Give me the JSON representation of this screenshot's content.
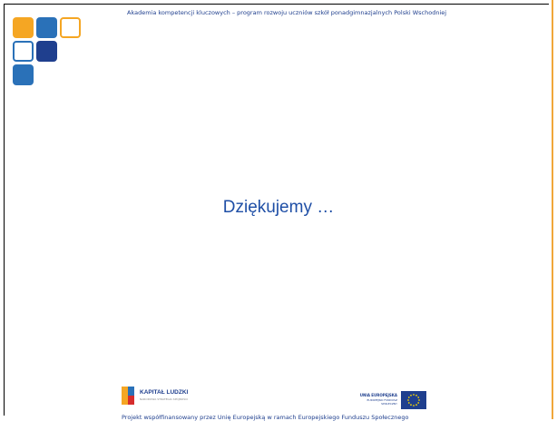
{
  "header": {
    "text": "Akademia kompetencji kluczowych – program rozwoju uczniów szkół ponadgimnazjalnych Polski Wschodniej"
  },
  "slide": {
    "main_text": "Dziękujemy …"
  },
  "footer": {
    "kapital_ludzki": {
      "title": "KAPITAŁ LUDZKI",
      "subtitle": "NARODOWA STRATEGIA SPÓJNOŚCI"
    },
    "unia_europejska": {
      "title": "UNIA EUROPEJSKA",
      "subtitle": "EUROPEJSKI FUNDUSZ SPOŁECZNY"
    },
    "funding_note": "Projekt współfinansowany przez Unię Europejską w ramach Europejskiego Funduszu Społecznego"
  },
  "colors": {
    "orange": "#f5a623",
    "blue": "#2a71b8",
    "navy": "#1f3f8e"
  }
}
